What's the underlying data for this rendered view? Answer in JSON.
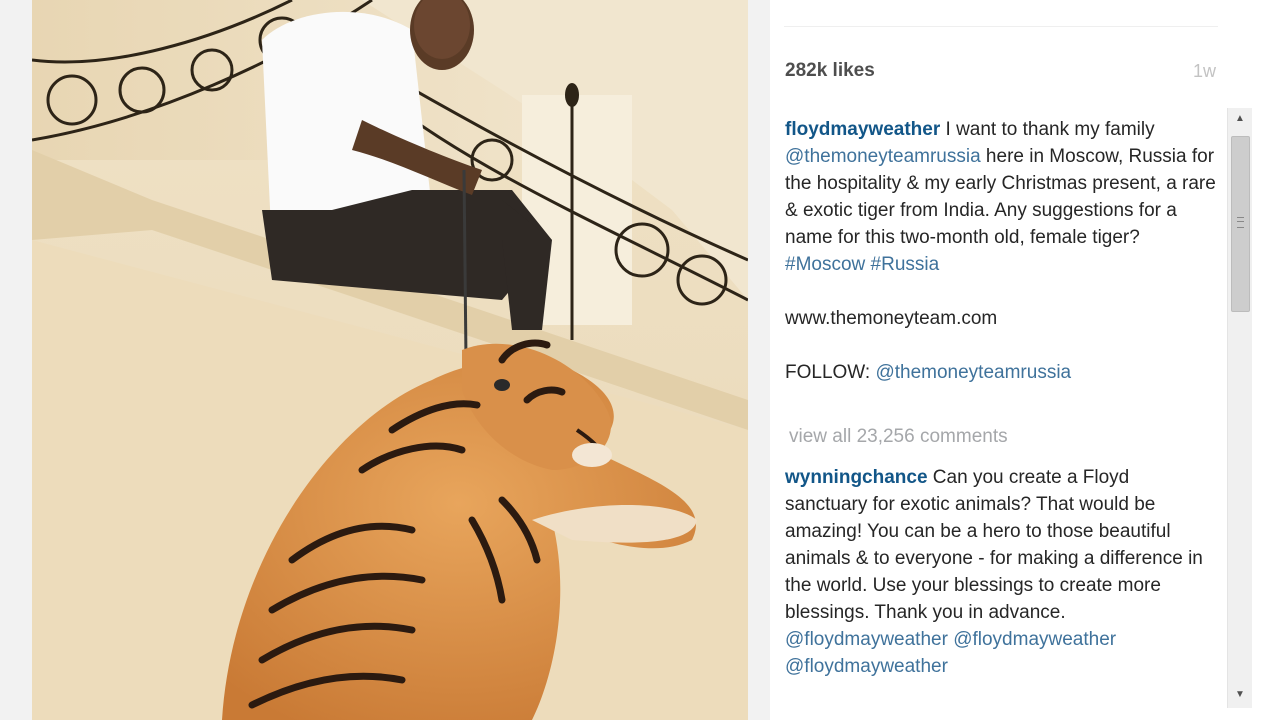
{
  "post": {
    "likes": "282k likes",
    "age": "1w"
  },
  "caption": {
    "username": "floydmayweather",
    "text_1": " I want to thank my family ",
    "mention_1": "@themoneyteamrussia",
    "text_2": " here in Moscow, Russia for the hospitality & my early Christmas present, a rare & exotic tiger from India. Any suggestions for a name for this two-month old, female tiger? ",
    "hashtag_1": "#Moscow",
    "hashtag_2": "#Russia",
    "website": "www.themoneyteam.com",
    "follow_label": "FOLLOW: ",
    "follow_mention": "@themoneyteamrussia"
  },
  "comments": {
    "view_all": "view all 23,256 comments",
    "items": [
      {
        "username": "wynningchance",
        "text": " Can you create a Floyd sanctuary for exotic animals? That would be amazing! You can be a hero to those beautiful animals & to everyone - for making a difference in the world. Use your blessings to create more blessings. Thank you in advance. ",
        "mention_1": "@floydmayweather",
        "mention_2": "@floydmayweather",
        "mention_3": "@floydmayweather"
      }
    ]
  },
  "scrollbar": {
    "up_icon": "scroll-up-arrow",
    "down_icon": "scroll-down-arrow",
    "position": 0
  },
  "colors": {
    "username": "#125688",
    "link": "#3f729b",
    "muted": "#a5a7aa"
  }
}
